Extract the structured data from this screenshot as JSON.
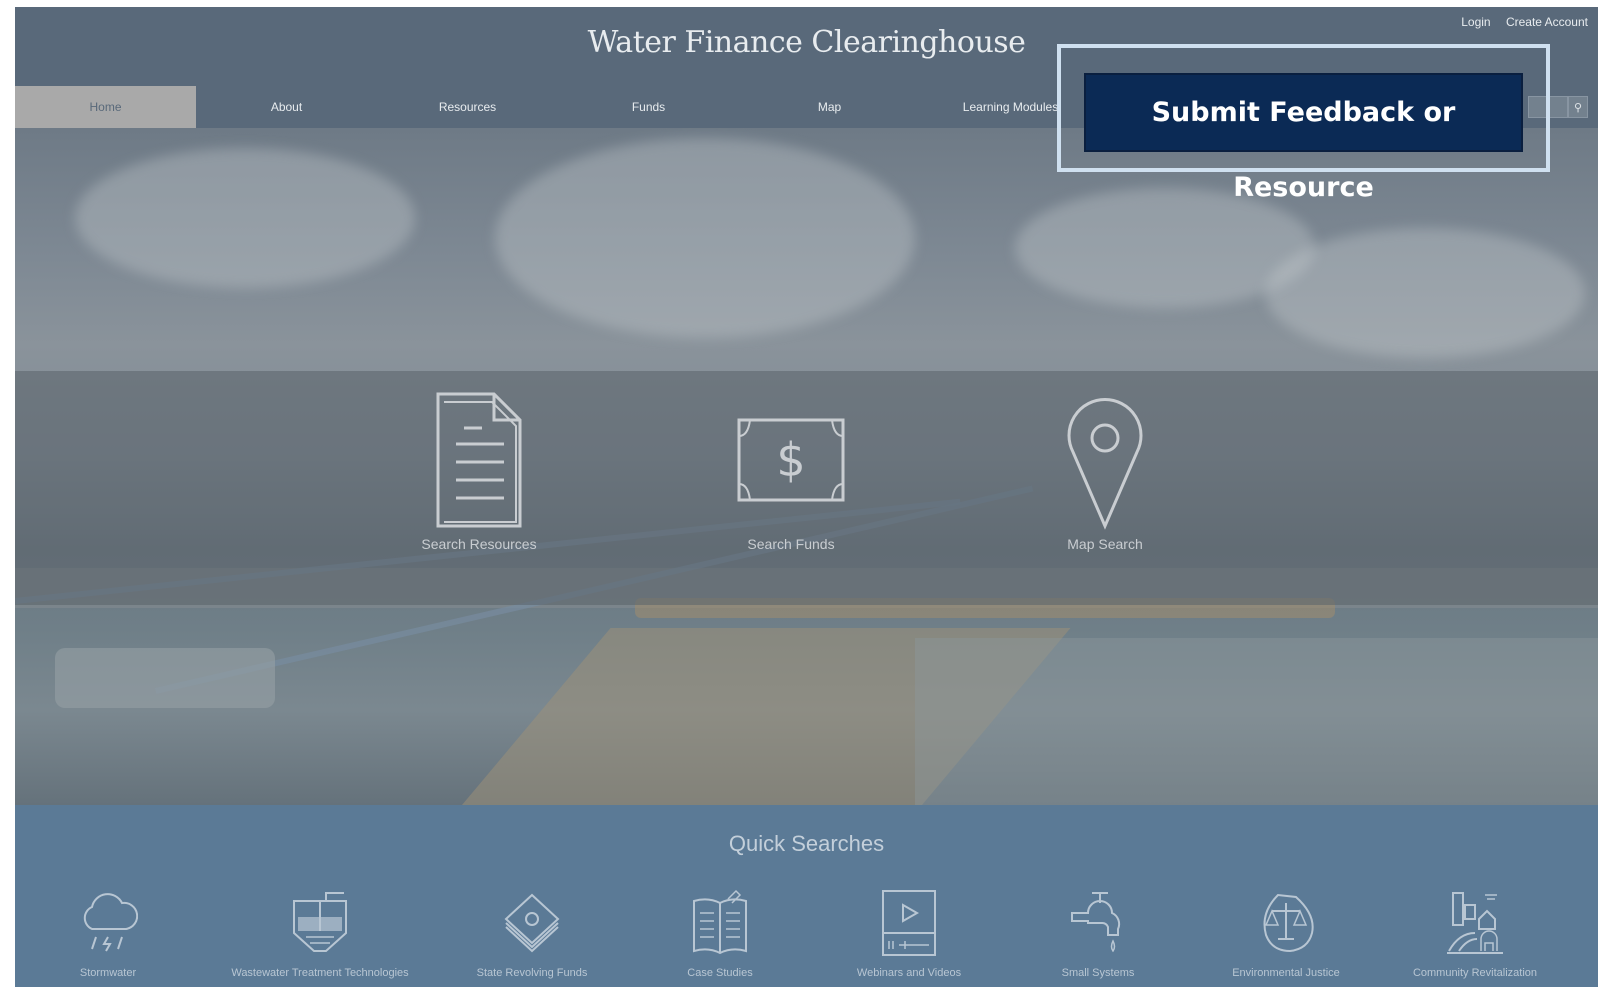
{
  "header": {
    "site_title": "Water Finance Clearinghouse",
    "login": "Login",
    "create_account": "Create Account"
  },
  "nav": {
    "items": [
      "Home",
      "About",
      "Resources",
      "Funds",
      "Map",
      "Learning Modules"
    ],
    "active": "Home",
    "search_icon": "magnifier-icon"
  },
  "tiles": [
    {
      "label": "Search Resources",
      "icon": "document-icon"
    },
    {
      "label": "Search Funds",
      "icon": "dollar-bill-icon"
    },
    {
      "label": "Map Search",
      "icon": "map-pin-icon"
    }
  ],
  "quick_searches": {
    "title": "Quick Searches",
    "items": [
      {
        "label": "Stormwater",
        "icon": "rain-cloud-icon"
      },
      {
        "label": "Wastewater Treatment Technologies",
        "icon": "treatment-tank-icon"
      },
      {
        "label": "State Revolving Funds",
        "icon": "money-stack-icon"
      },
      {
        "label": "Case Studies",
        "icon": "open-book-icon"
      },
      {
        "label": "Webinars and Videos",
        "icon": "video-player-icon"
      },
      {
        "label": "Small Systems",
        "icon": "faucet-icon"
      },
      {
        "label": "Environmental Justice",
        "icon": "scales-icon"
      },
      {
        "label": "Community Revitalization",
        "icon": "city-icon"
      }
    ]
  },
  "overlay": {
    "feedback_button": "Submit Feedback or Resource"
  },
  "colors": {
    "header_bg": "#59697a",
    "quick_bg": "#5b7a96",
    "button_bg": "#0b2a55",
    "highlight_border": "#cfe0f0"
  }
}
